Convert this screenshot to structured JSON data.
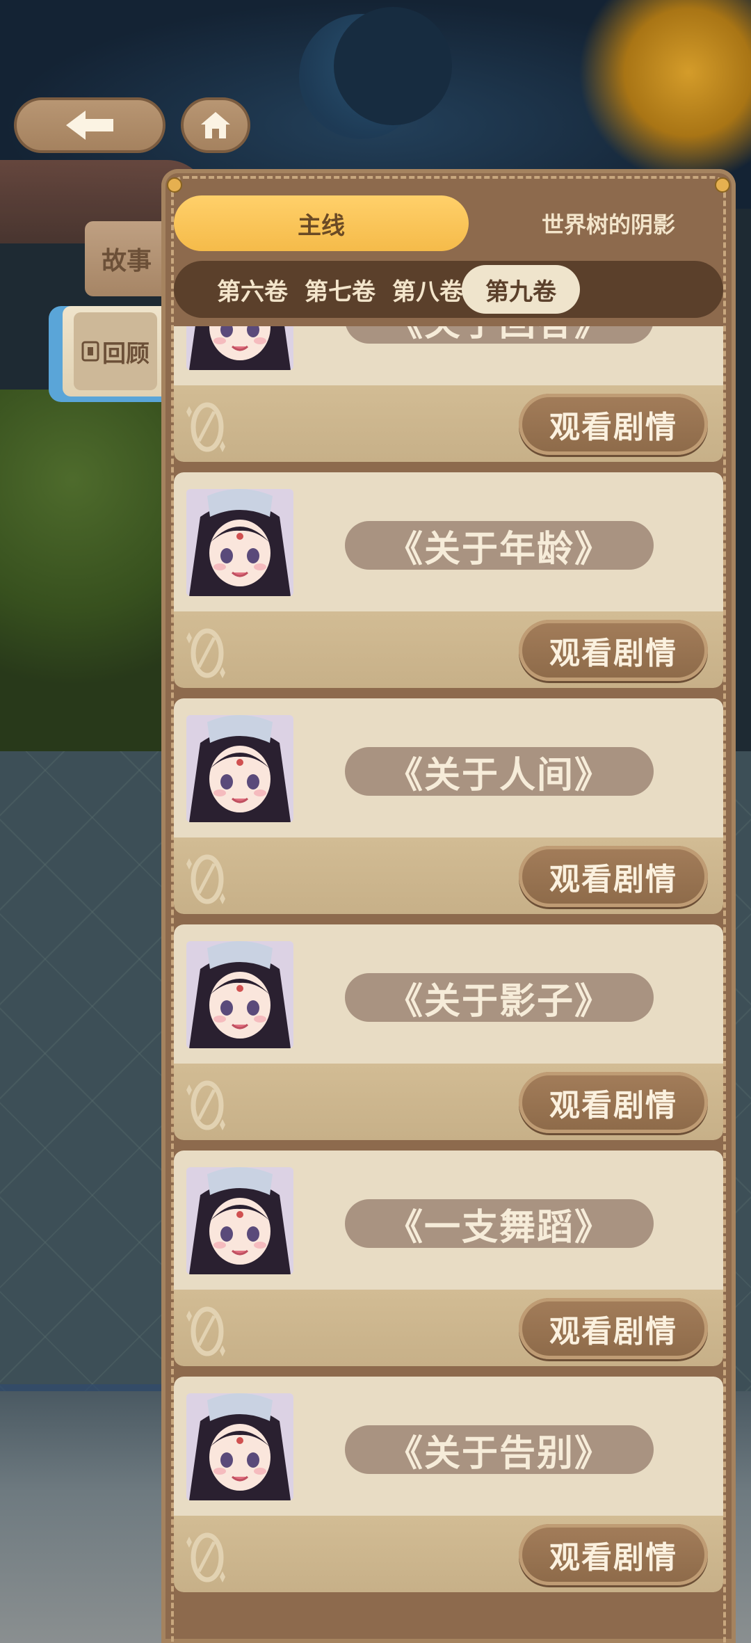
{
  "nav": {
    "back_icon": "arrow-left-icon",
    "home_icon": "home-icon"
  },
  "side_tabs": {
    "story": "故事",
    "review": "回顾"
  },
  "tabs": {
    "main_story": "主线",
    "world_tree": "世界树的阴影"
  },
  "volumes": [
    {
      "label": "第六卷",
      "active": false
    },
    {
      "label": "第七卷",
      "active": false
    },
    {
      "label": "第八卷",
      "active": false
    },
    {
      "label": "第九卷",
      "active": true
    }
  ],
  "episodes": [
    {
      "title": "《关于回答》",
      "button": "观看剧情"
    },
    {
      "title": "《关于年龄》",
      "button": "观看剧情"
    },
    {
      "title": "《关于人间》",
      "button": "观看剧情"
    },
    {
      "title": "《关于影子》",
      "button": "观看剧情"
    },
    {
      "title": "《一支舞蹈》",
      "button": "观看剧情"
    },
    {
      "title": "《关于告别》",
      "button": "观看剧情"
    }
  ],
  "colors": {
    "accent": "#f5bb4a",
    "panel": "#8d6a4d",
    "card": "#e8dcc4",
    "button": "#9a7452"
  }
}
